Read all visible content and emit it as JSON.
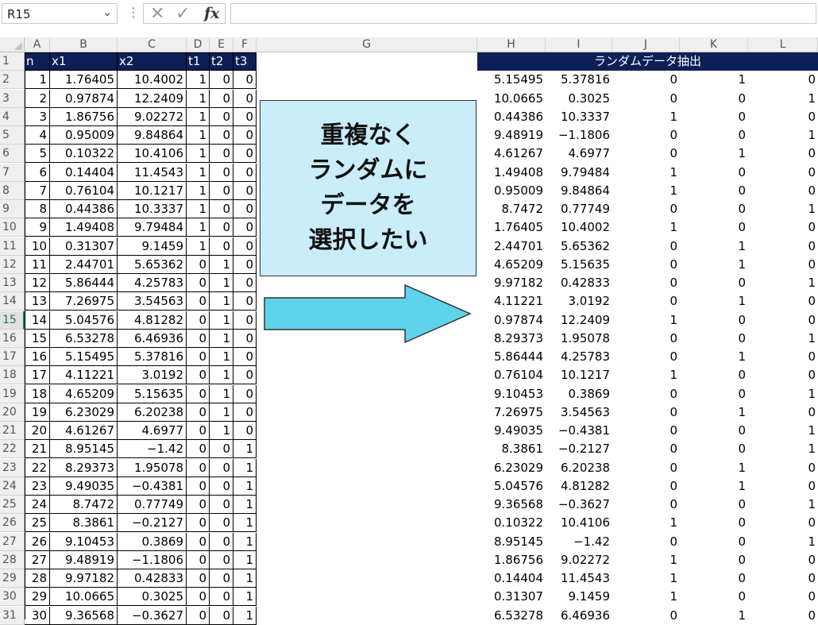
{
  "formula_bar": {
    "name_box": "R15",
    "fx": "fx",
    "formula": ""
  },
  "columns": [
    "A",
    "B",
    "C",
    "D",
    "E",
    "F",
    "G",
    "H",
    "I",
    "J",
    "K",
    "L"
  ],
  "header_row": [
    "n",
    "x1",
    "x2",
    "t1",
    "t2",
    "t3"
  ],
  "banner": "ランダムデータ抽出",
  "callout": [
    "重複なく",
    "ランダムに",
    "データを",
    "選択したい"
  ],
  "rows": [
    [
      1,
      "1.76405",
      "10.4002",
      1,
      0,
      0
    ],
    [
      2,
      "0.97874",
      "12.2409",
      1,
      0,
      0
    ],
    [
      3,
      "1.86756",
      "9.02272",
      1,
      0,
      0
    ],
    [
      4,
      "0.95009",
      "9.84864",
      1,
      0,
      0
    ],
    [
      5,
      "0.10322",
      "10.4106",
      1,
      0,
      0
    ],
    [
      6,
      "0.14404",
      "11.4543",
      1,
      0,
      0
    ],
    [
      7,
      "0.76104",
      "10.1217",
      1,
      0,
      0
    ],
    [
      8,
      "0.44386",
      "10.3337",
      1,
      0,
      0
    ],
    [
      9,
      "1.49408",
      "9.79484",
      1,
      0,
      0
    ],
    [
      10,
      "0.31307",
      "9.1459",
      1,
      0,
      0
    ],
    [
      11,
      "2.44701",
      "5.65362",
      0,
      1,
      0
    ],
    [
      12,
      "5.86444",
      "4.25783",
      0,
      1,
      0
    ],
    [
      13,
      "7.26975",
      "3.54563",
      0,
      1,
      0
    ],
    [
      14,
      "5.04576",
      "4.81282",
      0,
      1,
      0
    ],
    [
      15,
      "6.53278",
      "6.46936",
      0,
      1,
      0
    ],
    [
      16,
      "5.15495",
      "5.37816",
      0,
      1,
      0
    ],
    [
      17,
      "4.11221",
      "3.0192",
      0,
      1,
      0
    ],
    [
      18,
      "4.65209",
      "5.15635",
      0,
      1,
      0
    ],
    [
      19,
      "6.23029",
      "6.20238",
      0,
      1,
      0
    ],
    [
      20,
      "4.61267",
      "4.6977",
      0,
      1,
      0
    ],
    [
      21,
      "8.95145",
      "−1.42",
      0,
      0,
      1
    ],
    [
      22,
      "8.29373",
      "1.95078",
      0,
      0,
      1
    ],
    [
      23,
      "9.49035",
      "−0.4381",
      0,
      0,
      1
    ],
    [
      24,
      "8.7472",
      "0.77749",
      0,
      0,
      1
    ],
    [
      25,
      "8.3861",
      "−0.2127",
      0,
      0,
      1
    ],
    [
      26,
      "9.10453",
      "0.3869",
      0,
      0,
      1
    ],
    [
      27,
      "9.48919",
      "−1.1806",
      0,
      0,
      1
    ],
    [
      28,
      "9.97182",
      "0.42833",
      0,
      0,
      1
    ],
    [
      29,
      "10.0665",
      "0.3025",
      0,
      0,
      1
    ],
    [
      30,
      "9.36568",
      "−0.3627",
      0,
      0,
      1
    ]
  ],
  "random_rows": [
    [
      "5.15495",
      "5.37816",
      0,
      1,
      0
    ],
    [
      "10.0665",
      "0.3025",
      0,
      0,
      1
    ],
    [
      "0.44386",
      "10.3337",
      1,
      0,
      0
    ],
    [
      "9.48919",
      "−1.1806",
      0,
      0,
      1
    ],
    [
      "4.61267",
      "4.6977",
      0,
      1,
      0
    ],
    [
      "1.49408",
      "9.79484",
      1,
      0,
      0
    ],
    [
      "0.95009",
      "9.84864",
      1,
      0,
      0
    ],
    [
      "8.7472",
      "0.77749",
      0,
      0,
      1
    ],
    [
      "1.76405",
      "10.4002",
      1,
      0,
      0
    ],
    [
      "2.44701",
      "5.65362",
      0,
      1,
      0
    ],
    [
      "4.65209",
      "5.15635",
      0,
      1,
      0
    ],
    [
      "9.97182",
      "0.42833",
      0,
      0,
      1
    ],
    [
      "4.11221",
      "3.0192",
      0,
      1,
      0
    ],
    [
      "0.97874",
      "12.2409",
      1,
      0,
      0
    ],
    [
      "8.29373",
      "1.95078",
      0,
      0,
      1
    ],
    [
      "5.86444",
      "4.25783",
      0,
      1,
      0
    ],
    [
      "0.76104",
      "10.1217",
      1,
      0,
      0
    ],
    [
      "9.10453",
      "0.3869",
      0,
      0,
      1
    ],
    [
      "7.26975",
      "3.54563",
      0,
      1,
      0
    ],
    [
      "9.49035",
      "−0.4381",
      0,
      0,
      1
    ],
    [
      "8.3861",
      "−0.2127",
      0,
      0,
      1
    ],
    [
      "6.23029",
      "6.20238",
      0,
      1,
      0
    ],
    [
      "5.04576",
      "4.81282",
      0,
      1,
      0
    ],
    [
      "9.36568",
      "−0.3627",
      0,
      0,
      1
    ],
    [
      "0.10322",
      "10.4106",
      1,
      0,
      0
    ],
    [
      "8.95145",
      "−1.42",
      0,
      0,
      1
    ],
    [
      "1.86756",
      "9.02272",
      1,
      0,
      0
    ],
    [
      "0.14404",
      "11.4543",
      1,
      0,
      0
    ],
    [
      "0.31307",
      "9.1459",
      1,
      0,
      0
    ],
    [
      "6.53278",
      "6.46936",
      0,
      1,
      0
    ]
  ],
  "selected_row": 15,
  "colors": {
    "header_bg": "#0d1f57",
    "callout_bg": "#c9eefa",
    "arrow_fill": "#5fd3ec",
    "select_green": "#217346"
  }
}
